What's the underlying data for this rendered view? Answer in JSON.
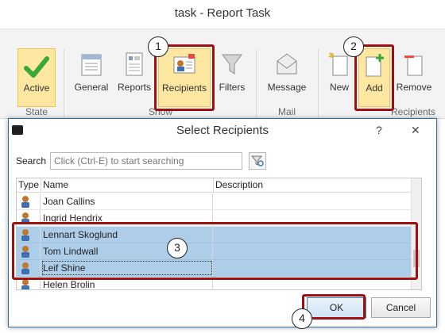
{
  "window": {
    "title": "task - Report Task"
  },
  "ribbon": {
    "buttons": [
      {
        "label": "Active",
        "icon": "checkmark-icon"
      },
      {
        "label": "General",
        "icon": "general-icon"
      },
      {
        "label": "Reports",
        "icon": "reports-icon"
      },
      {
        "label": "Recipients",
        "icon": "recipients-icon"
      },
      {
        "label": "Filters",
        "icon": "funnel-icon"
      },
      {
        "label": "Message",
        "icon": "envelope-icon"
      },
      {
        "label": "New",
        "icon": "new-document-icon"
      },
      {
        "label": "Add",
        "icon": "add-document-icon"
      },
      {
        "label": "Remove",
        "icon": "remove-document-icon"
      }
    ],
    "groups": {
      "state": "State",
      "show": "Show",
      "mail": "Mail",
      "recipients": "Recipients"
    }
  },
  "callouts": [
    "1",
    "2",
    "3",
    "4"
  ],
  "dialog": {
    "title": "Select Recipients",
    "help": "?",
    "close": "✕",
    "search": {
      "label": "Search",
      "placeholder": "Click (Ctrl-E) to start searching"
    },
    "columns": {
      "type": "Type",
      "name": "Name",
      "description": "Description"
    },
    "rows": [
      {
        "name": "Joan Callins",
        "description": "",
        "selected": false
      },
      {
        "name": "Ingrid Hendrix",
        "description": "",
        "selected": false
      },
      {
        "name": "Lennart Skoglund",
        "description": "",
        "selected": true
      },
      {
        "name": "Tom Lindwall",
        "description": "",
        "selected": true
      },
      {
        "name": "Leif Shine",
        "description": "",
        "selected": true
      },
      {
        "name": "Helen Brolin",
        "description": "",
        "selected": false
      }
    ],
    "buttons": {
      "ok": "OK",
      "cancel": "Cancel"
    }
  },
  "colors": {
    "highlight": "#fde7a1",
    "selection": "#aecde9",
    "callout_border": "#a01010",
    "accent_green": "#39a838"
  }
}
